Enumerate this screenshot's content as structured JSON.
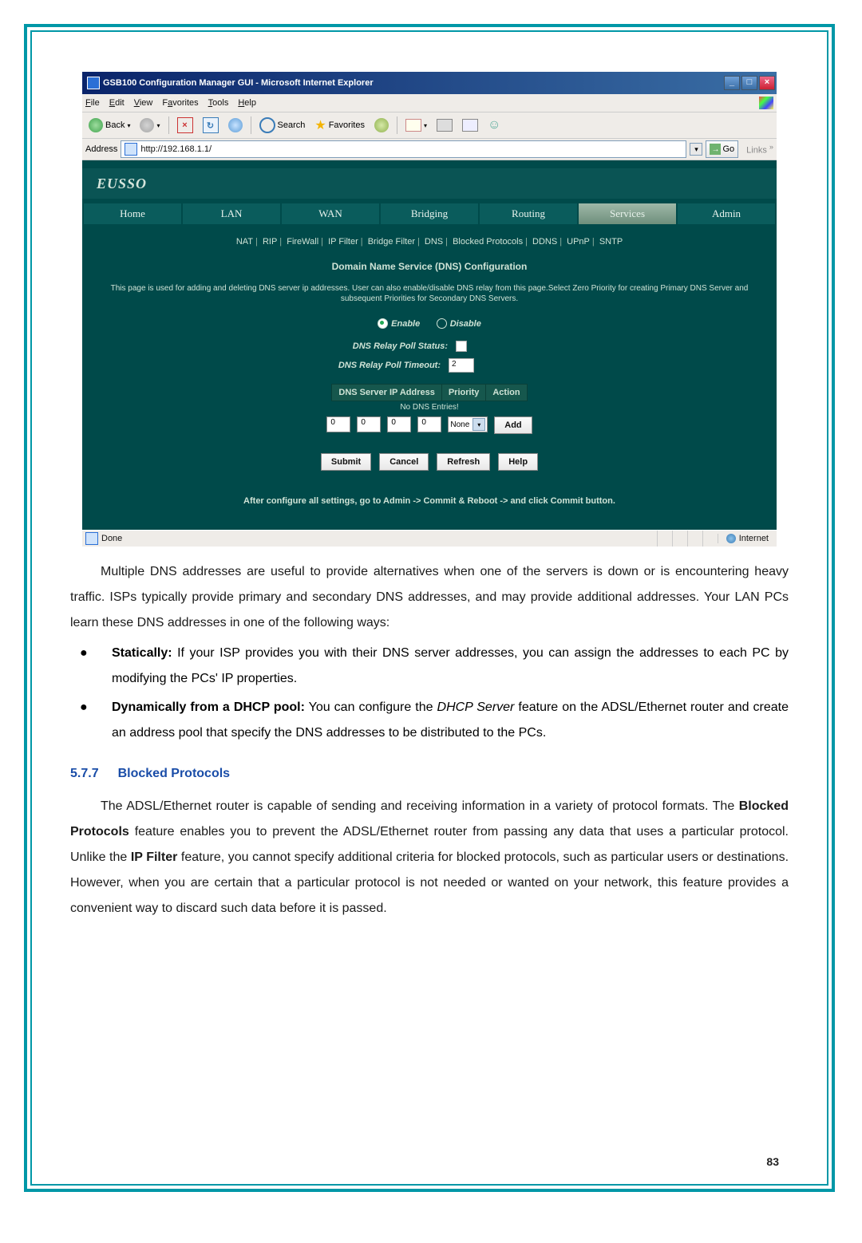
{
  "window": {
    "title": "GSB100 Configuration Manager GUI - Microsoft Internet Explorer",
    "menu": {
      "file": "File",
      "edit": "Edit",
      "view": "View",
      "favorites": "Favorites",
      "tools": "Tools",
      "help": "Help"
    },
    "toolbar": {
      "back": "Back",
      "search": "Search",
      "favorites": "Favorites"
    },
    "address": {
      "label": "Address",
      "url": "http://192.168.1.1/",
      "go": "Go",
      "links": "Links"
    },
    "status": {
      "done": "Done",
      "zone": "Internet"
    }
  },
  "app": {
    "logo": "EUSSO",
    "main_tabs": [
      "Home",
      "LAN",
      "WAN",
      "Bridging",
      "Routing",
      "Services",
      "Admin"
    ],
    "main_tab_active_index": 5,
    "subtabs": [
      "NAT",
      "RIP",
      "FireWall",
      "IP Filter",
      "Bridge Filter",
      "DNS",
      "Blocked Protocols",
      "DDNS",
      "UPnP",
      "SNTP"
    ],
    "page_title": "Domain Name Service (DNS) Configuration",
    "description": "This page is used for adding and deleting DNS server ip addresses. User can also enable/disable DNS relay from this page.Select Zero Priority for creating Primary DNS Server and subsequent Priorities for Secondary DNS Servers.",
    "radio": {
      "enable": "Enable",
      "disable": "Disable"
    },
    "fields": {
      "poll_status_label": "DNS Relay Poll Status:",
      "poll_timeout_label": "DNS Relay Poll Timeout:",
      "poll_timeout_value": "2"
    },
    "table": {
      "headers": [
        "DNS Server IP Address",
        "Priority",
        "Action"
      ],
      "empty": "No DNS Entries!",
      "octets": [
        "0",
        "0",
        "0",
        "0"
      ],
      "priority_selected": "None",
      "add_btn": "Add"
    },
    "buttons": {
      "submit": "Submit",
      "cancel": "Cancel",
      "refresh": "Refresh",
      "help": "Help"
    },
    "footer_note": "After configure all settings, go to Admin -> Commit & Reboot -> and click Commit button."
  },
  "doc": {
    "para1": "Multiple DNS addresses are useful to provide alternatives when one of the servers is down or is encountering heavy traffic. ISPs typically provide primary and secondary DNS addresses, and may provide additional addresses. Your LAN PCs learn these DNS addresses in one of the following ways:",
    "bullet1_strong": "Statically:",
    "bullet1_rest": " If your ISP provides you with their DNS server addresses, you can assign the addresses to each PC by modifying the PCs' IP properties.",
    "bullet2_strong": "Dynamically from a DHCP pool:",
    "bullet2_mid": " You can configure the ",
    "bullet2_em": "DHCP Server",
    "bullet2_rest": " feature on the ADSL/Ethernet router and create an address pool that specify the DNS addresses to be distributed to the PCs.",
    "section_num": "5.7.7",
    "section_title": "Blocked Protocols",
    "para2a": "The ADSL/Ethernet router is capable of sending and receiving information in a variety of protocol formats. The ",
    "para2b_strong": "Blocked Protocols",
    "para2c": " feature enables you to prevent the ADSL/Ethernet router from passing any data that uses a particular protocol. Unlike the ",
    "para2d_strong": "IP Filter",
    "para2e": " feature, you cannot specify additional criteria for blocked protocols, such as particular users or destinations. However, when you are certain that a particular protocol is not needed or wanted on your network, this feature provides a convenient way to discard such data before it is passed.",
    "page_number": "83"
  }
}
